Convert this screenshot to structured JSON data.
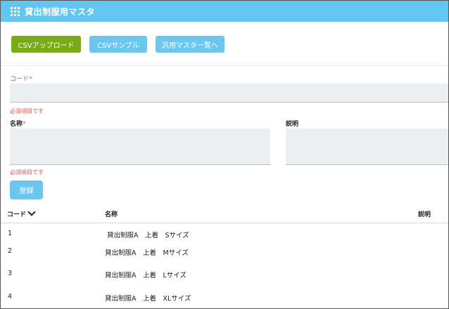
{
  "header": {
    "title": "貸出制服用マスタ",
    "icon": "grid-icon"
  },
  "toolbar": {
    "csv_upload_label": "CSVアップロード",
    "csv_sample_label": "CSVサンプル",
    "master_list_label": "汎用マスタ一覧へ"
  },
  "form": {
    "code": {
      "label": "コード",
      "required_mark": "*",
      "value": "",
      "error": "必須項目です"
    },
    "name": {
      "label": "名称",
      "required_mark": "*",
      "value": "",
      "error": "必須項目です"
    },
    "description": {
      "label": "説明",
      "value": ""
    },
    "submit_label": "登録"
  },
  "table": {
    "headers": {
      "code": "コード",
      "name": "名称",
      "description": "説明"
    },
    "rows": [
      {
        "code": "1",
        "name": " 貸出制服A　上着　Sサイズ",
        "description": ""
      },
      {
        "code": "2",
        "name": "貸出制服A　上着　Mサイズ",
        "description": ""
      },
      {
        "code": "3",
        "name": "貸出制服A　上着　Lサイズ",
        "description": ""
      },
      {
        "code": "4",
        "name": "貸出制服A　上着　XLサイズ",
        "description": ""
      }
    ]
  },
  "colors": {
    "header": "#62c6f0",
    "primary_green": "#7aaa17",
    "button_blue": "#6cc7f0",
    "error_red": "#d9534f"
  }
}
